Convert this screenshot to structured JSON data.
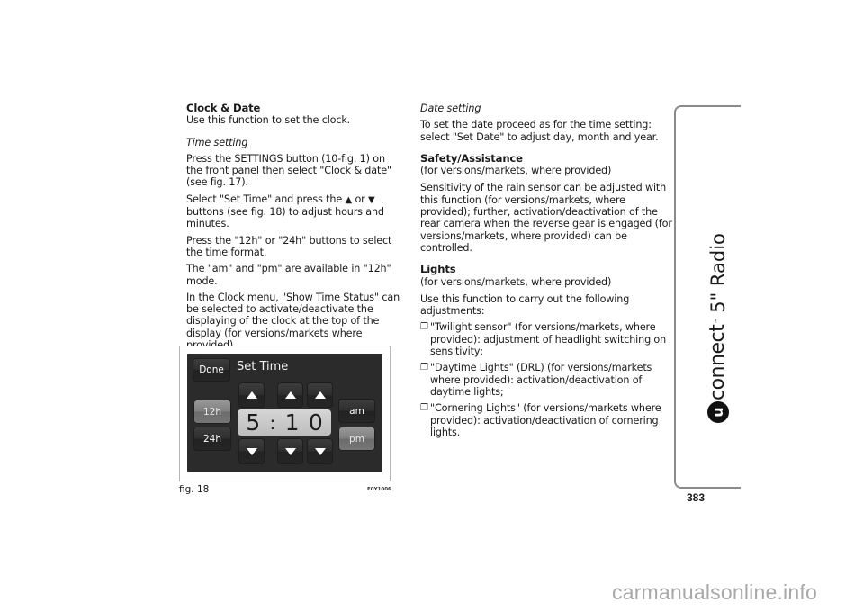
{
  "left_column": {
    "heading": "Clock & Date",
    "intro": "Use this function to set the clock.",
    "subheading": "Time setting",
    "paragraphs": [
      "Press the SETTINGS button (10-fig. 1) on the front panel then select \"Clock & date\" (see fig. 17).",
      "Select \"Set Time\" and press the",
      "or",
      "buttons (see fig. 18) to adjust hours and minutes.",
      "Press the \"12h\" or \"24h\" buttons to select the time format.",
      "The \"am\" and \"pm\" are available in \"12h\" mode.",
      "In the Clock menu, \"Show Time Status\" can be selected to activate/deactivate the displaying of the clock at the top of the display (for versions/markets where provided)."
    ],
    "up_glyph": "▲",
    "down_glyph": "▼"
  },
  "figure": {
    "screen": {
      "done_label": "Done",
      "title": "Set Time",
      "format_12h": "12h",
      "format_24h": "24h",
      "am_label": "am",
      "pm_label": "pm",
      "selected_format": "12h",
      "selected_period": "pm",
      "time_digits": [
        "5",
        ":",
        "1",
        "0"
      ]
    },
    "caption": "fig. 18",
    "code": "F0Y1006"
  },
  "right_column": {
    "date_subheading": "Date setting",
    "date_text": "To set the date proceed as for the time setting: select \"Set Date\" to adjust day, month and year.",
    "safety_heading": "Safety/Assistance",
    "safety_note": "(for versions/markets, where provided)",
    "safety_text": "Sensitivity of the rain sensor can be adjusted with this function (for versions/markets, where provided); further, activation/deactivation of the rear camera when the reverse gear is engaged (for versions/markets, where provided) can be controlled.",
    "lights_heading": "Lights",
    "lights_note": "(for versions/markets, where provided)",
    "lights_intro": "Use this function to carry out the following adjustments:",
    "bullet_glyph": "❒",
    "bullets": [
      "\"Twilight sensor\" (for versions/markets, where provided): adjustment of headlight switching on sensitivity;",
      "\"Daytime Lights\" (DRL) (for versions/markets where provided): activation/deactivation of daytime lights;",
      "\"Cornering Lights\" (for versions/markets where provided): activation/deactivation of cornering lights."
    ]
  },
  "side_tab": {
    "logo_letter": "u",
    "logo_text": "connect",
    "trademark": "™",
    "section": "5\" Radio"
  },
  "page_number": "383",
  "watermark": "carmanualsonline.info"
}
